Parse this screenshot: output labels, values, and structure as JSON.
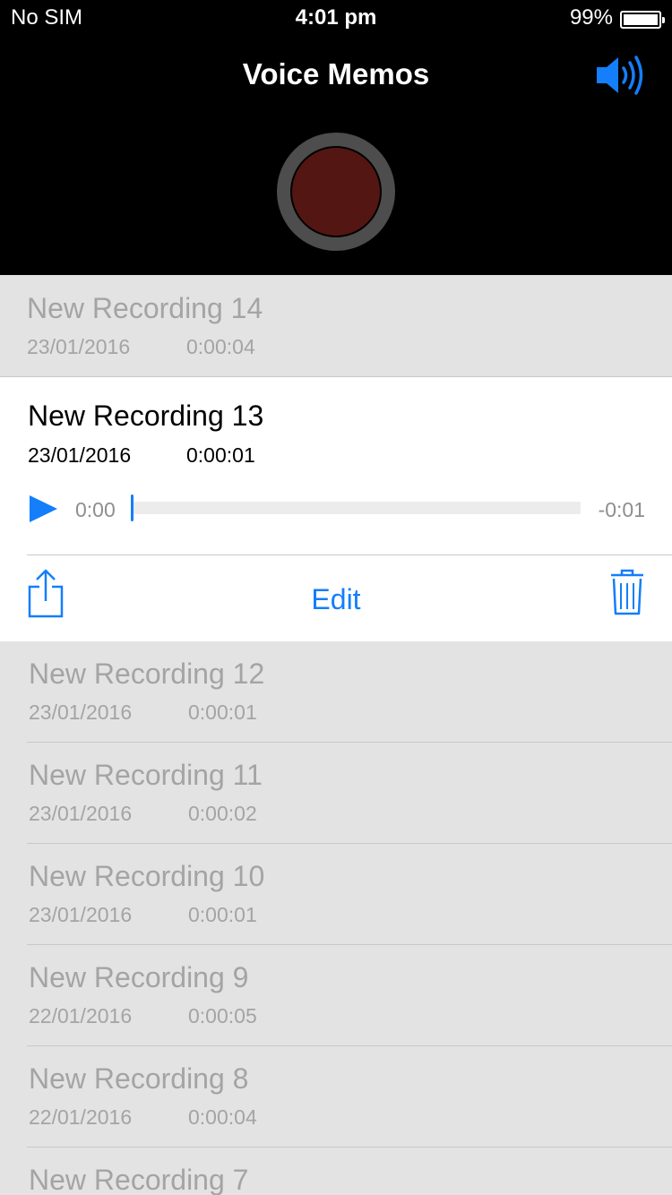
{
  "status_bar": {
    "carrier": "No SIM",
    "time": "4:01 pm",
    "battery_text": "99%",
    "battery_level": 0.99
  },
  "nav": {
    "title": "Voice Memos"
  },
  "accent_color": "#147efb",
  "record_color": "#541612",
  "recordings": [
    {
      "name": "New Recording 14",
      "date": "23/01/2016",
      "duration": "0:00:04"
    },
    {
      "name": "New Recording 13",
      "date": "23/01/2016",
      "duration": "0:00:01",
      "expanded": true
    },
    {
      "name": "New Recording 12",
      "date": "23/01/2016",
      "duration": "0:00:01"
    },
    {
      "name": "New Recording 11",
      "date": "23/01/2016",
      "duration": "0:00:02"
    },
    {
      "name": "New Recording 10",
      "date": "23/01/2016",
      "duration": "0:00:01"
    },
    {
      "name": "New Recording 9",
      "date": "22/01/2016",
      "duration": "0:00:05"
    },
    {
      "name": "New Recording 8",
      "date": "22/01/2016",
      "duration": "0:00:04"
    },
    {
      "name": "New Recording 7"
    }
  ],
  "player": {
    "elapsed": "0:00",
    "remaining": "-0:01",
    "progress": 0,
    "edit_label": "Edit",
    "icons": [
      "play-icon",
      "share-icon",
      "trash-icon",
      "speaker-icon"
    ]
  }
}
